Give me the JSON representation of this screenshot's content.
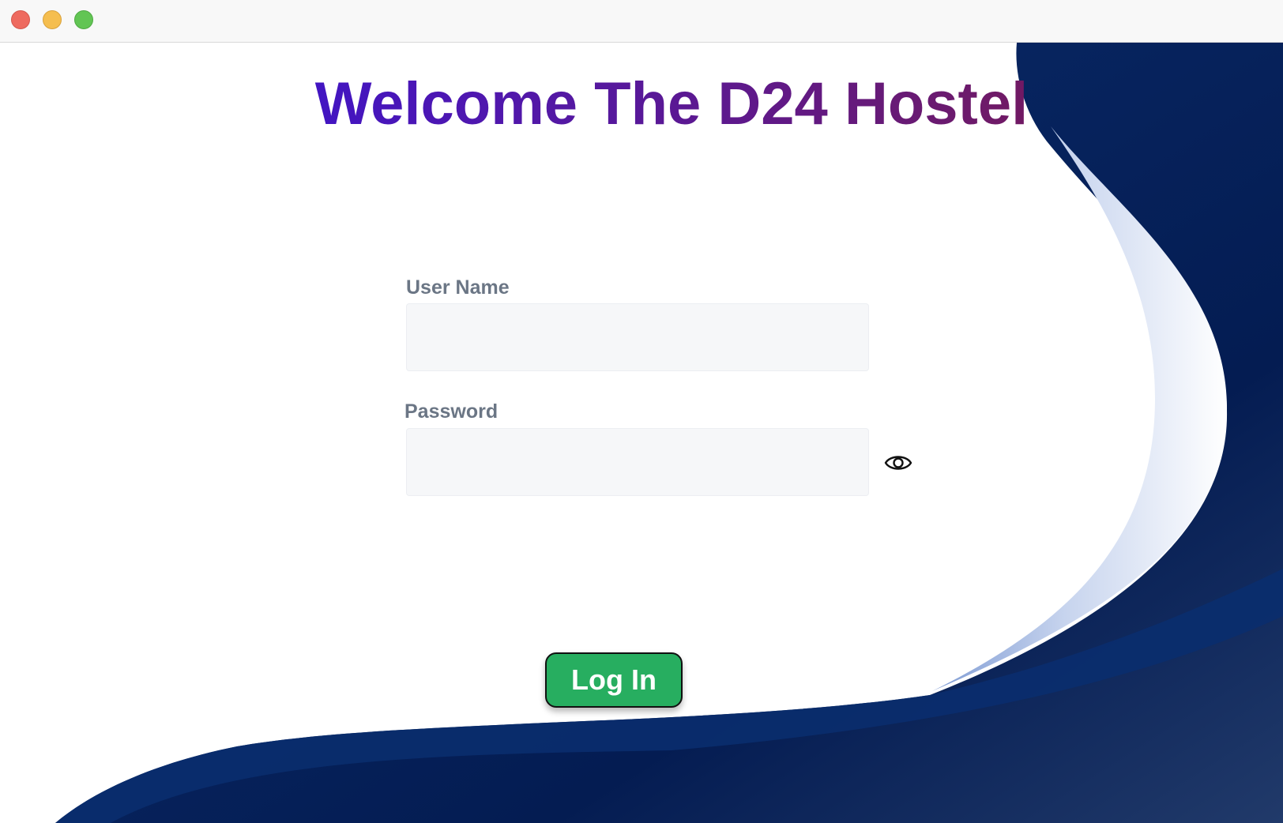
{
  "window": {
    "controls": [
      "close",
      "minimize",
      "maximize"
    ]
  },
  "header": {
    "title": "Welcome The D24 Hostel"
  },
  "form": {
    "username_label": "User Name",
    "username_value": "",
    "password_label": "Password",
    "password_value": "",
    "password_toggle_icon": "eye-icon",
    "login_label": "Log In"
  },
  "colors": {
    "title_gradient_start": "#2a10e6",
    "title_gradient_end": "#8a1535",
    "wave_dark_blue": "#0a2e6e",
    "wave_light_blue": "#b8c9ea",
    "login_button_green": "#27ae60",
    "input_background": "#f6f7f9",
    "label_gray": "#6b7685"
  }
}
